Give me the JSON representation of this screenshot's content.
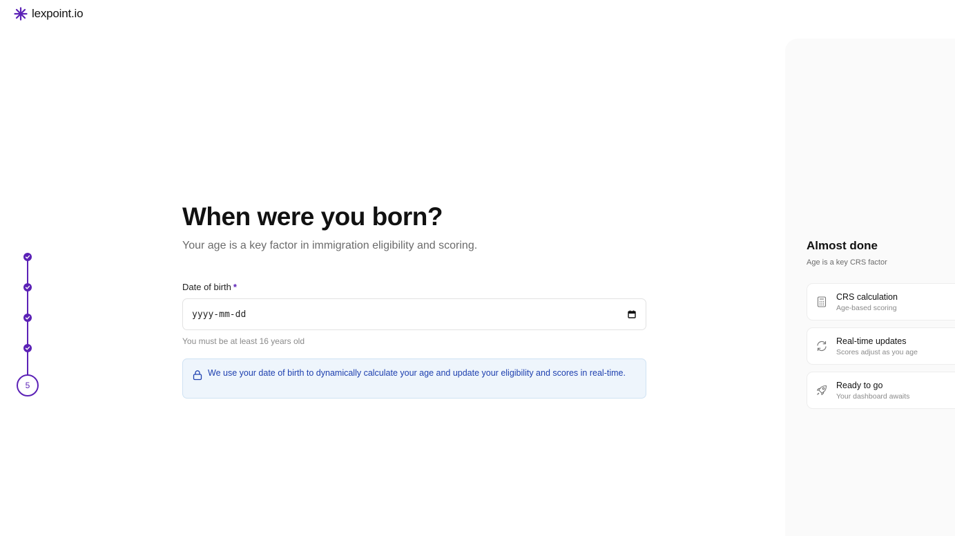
{
  "brand": {
    "name": "lexpoint.io",
    "accent": "#5b21b6"
  },
  "stepper": {
    "completed_steps": 4,
    "current_step": "5"
  },
  "form": {
    "title": "When were you born?",
    "subtitle": "Your age is a key factor in immigration eligibility and scoring.",
    "field_label": "Date of birth",
    "required_marker": "*",
    "date_placeholder": "yyyy-mm-dd",
    "hint": "You must be at least 16 years old",
    "info": "We use your date of birth to dynamically calculate your age and update your eligibility and scores in real-time."
  },
  "side": {
    "title": "Almost done",
    "subtitle": "Age is a key CRS factor",
    "cards": [
      {
        "title": "CRS calculation",
        "subtitle": "Age-based scoring",
        "icon": "calculator-icon"
      },
      {
        "title": "Real-time updates",
        "subtitle": "Scores adjust as you age",
        "icon": "refresh-icon"
      },
      {
        "title": "Ready to go",
        "subtitle": "Your dashboard awaits",
        "icon": "rocket-icon"
      }
    ]
  }
}
